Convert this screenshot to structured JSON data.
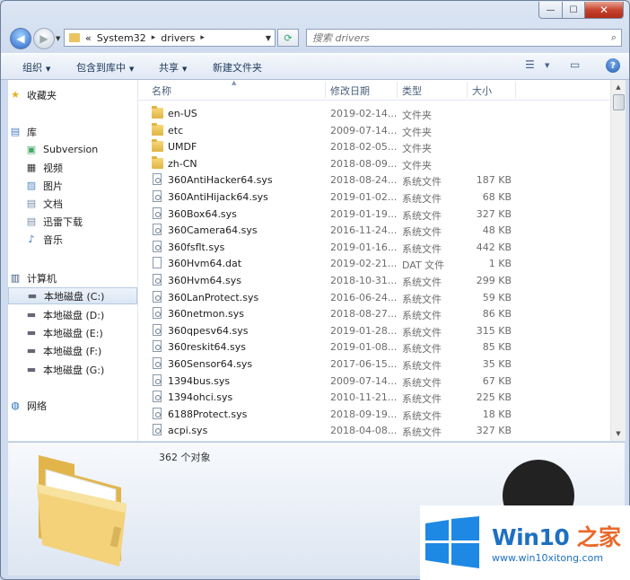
{
  "address": {
    "breadcrumb_prefix": "«",
    "path": [
      "System32",
      "drivers"
    ]
  },
  "search": {
    "placeholder": "搜索 drivers"
  },
  "toolbar": {
    "organize": "组织",
    "include": "包含到库中",
    "share": "共享",
    "new_folder": "新建文件夹"
  },
  "nav": {
    "favorites": "收藏夹",
    "library": "库",
    "library_items": [
      "Subversion",
      "视频",
      "图片",
      "文档",
      "迅雷下载",
      "音乐"
    ],
    "computer": "计算机",
    "drives": [
      "本地磁盘 (C:)",
      "本地磁盘 (D:)",
      "本地磁盘 (E:)",
      "本地磁盘 (F:)",
      "本地磁盘 (G:)"
    ],
    "network": "网络"
  },
  "columns": {
    "name": "名称",
    "date": "修改日期",
    "type": "类型",
    "size": "大小"
  },
  "files": [
    {
      "name": "en-US",
      "date": "2019-02-14...",
      "type": "文件夹",
      "size": "",
      "kind": "folder"
    },
    {
      "name": "etc",
      "date": "2009-07-14...",
      "type": "文件夹",
      "size": "",
      "kind": "folder"
    },
    {
      "name": "UMDF",
      "date": "2018-02-05...",
      "type": "文件夹",
      "size": "",
      "kind": "folder"
    },
    {
      "name": "zh-CN",
      "date": "2018-08-09...",
      "type": "文件夹",
      "size": "",
      "kind": "folder"
    },
    {
      "name": "360AntiHacker64.sys",
      "date": "2018-08-24...",
      "type": "系统文件",
      "size": "187 KB",
      "kind": "sys"
    },
    {
      "name": "360AntiHijack64.sys",
      "date": "2019-01-02...",
      "type": "系统文件",
      "size": "68 KB",
      "kind": "sys"
    },
    {
      "name": "360Box64.sys",
      "date": "2019-01-19...",
      "type": "系统文件",
      "size": "327 KB",
      "kind": "sys"
    },
    {
      "name": "360Camera64.sys",
      "date": "2016-11-24...",
      "type": "系统文件",
      "size": "48 KB",
      "kind": "sys"
    },
    {
      "name": "360fsflt.sys",
      "date": "2019-01-16...",
      "type": "系统文件",
      "size": "442 KB",
      "kind": "sys"
    },
    {
      "name": "360Hvm64.dat",
      "date": "2019-02-21...",
      "type": "DAT 文件",
      "size": "1 KB",
      "kind": "dat"
    },
    {
      "name": "360Hvm64.sys",
      "date": "2018-10-31...",
      "type": "系统文件",
      "size": "299 KB",
      "kind": "sys"
    },
    {
      "name": "360LanProtect.sys",
      "date": "2016-06-24...",
      "type": "系统文件",
      "size": "59 KB",
      "kind": "sys"
    },
    {
      "name": "360netmon.sys",
      "date": "2018-08-27...",
      "type": "系统文件",
      "size": "86 KB",
      "kind": "sys"
    },
    {
      "name": "360qpesv64.sys",
      "date": "2019-01-28...",
      "type": "系统文件",
      "size": "315 KB",
      "kind": "sys"
    },
    {
      "name": "360reskit64.sys",
      "date": "2019-01-08...",
      "type": "系统文件",
      "size": "85 KB",
      "kind": "sys"
    },
    {
      "name": "360Sensor64.sys",
      "date": "2017-06-15...",
      "type": "系统文件",
      "size": "35 KB",
      "kind": "sys"
    },
    {
      "name": "1394bus.sys",
      "date": "2009-07-14...",
      "type": "系统文件",
      "size": "67 KB",
      "kind": "sys"
    },
    {
      "name": "1394ohci.sys",
      "date": "2010-11-21...",
      "type": "系统文件",
      "size": "225 KB",
      "kind": "sys"
    },
    {
      "name": "6188Protect.sys",
      "date": "2018-09-19...",
      "type": "系统文件",
      "size": "18 KB",
      "kind": "sys"
    },
    {
      "name": "acpi.sys",
      "date": "2018-04-08...",
      "type": "系统文件",
      "size": "327 KB",
      "kind": "sys"
    }
  ],
  "status": {
    "count": "362 个对象"
  },
  "watermark": {
    "brand_win": "Win10",
    "brand_rest": " 之家",
    "url": "www.win10xitong.com"
  }
}
